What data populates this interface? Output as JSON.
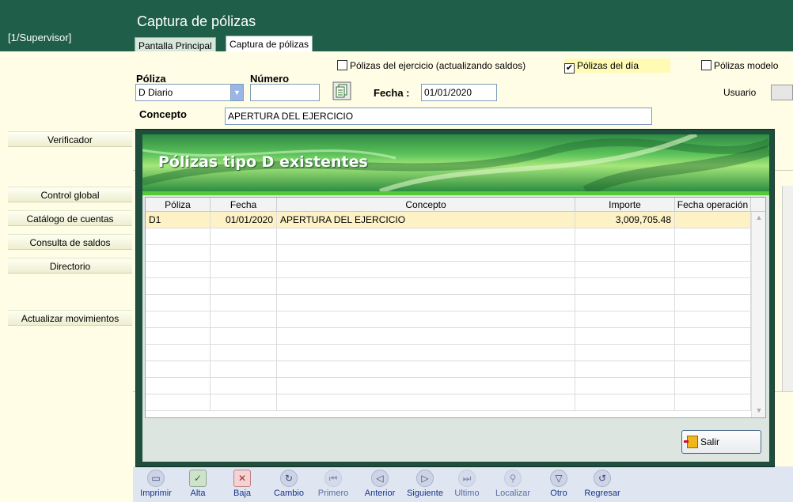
{
  "header": {
    "title": "Captura de pólizas",
    "user": "[1/Supervisor]",
    "tabs": [
      {
        "label": "Pantalla Principal",
        "active": false
      },
      {
        "label": "Captura de pólizas",
        "active": true
      }
    ]
  },
  "sidebar": {
    "items": [
      {
        "label": "Verificador"
      },
      {
        "label": "Control global"
      },
      {
        "label": "Catálogo de cuentas"
      },
      {
        "label": "Consulta de saldos"
      },
      {
        "label": "Directorio"
      },
      {
        "label": "Actualizar movimientos"
      }
    ]
  },
  "form": {
    "checks": [
      {
        "label": "Pólizas del ejercicio (actualizando saldos)",
        "checked": false
      },
      {
        "label": "Pólizas del día",
        "checked": true
      },
      {
        "label": "Pólizas modelo",
        "checked": false
      }
    ],
    "poliza_label": "Póliza",
    "poliza_value": "D Diario",
    "numero_label": "Número",
    "numero_value": "",
    "fecha_label": "Fecha :",
    "fecha_value": "01/01/2020",
    "usuario_label": "Usuario",
    "concepto_label": "Concepto",
    "concepto_value": "APERTURA DEL EJERCICIO"
  },
  "modal": {
    "title": "Pólizas tipo D existentes",
    "columns": [
      "Póliza",
      "Fecha",
      "Concepto",
      "Importe",
      "Fecha operación"
    ],
    "rows": [
      {
        "poliza": "D1",
        "fecha": "01/01/2020",
        "concepto": "APERTURA DEL EJERCICIO",
        "importe": "3,009,705.48",
        "fecha_operacion": ""
      }
    ],
    "salir_label": "Salir",
    "colors": {
      "frame": "#1e4e3c",
      "accent": "#55c83a",
      "selected_row": "#fdf2c6"
    }
  },
  "toolbar": {
    "buttons": [
      {
        "label": "Imprimir",
        "icon": "printer-icon"
      },
      {
        "label": "Alta",
        "icon": "add-icon"
      },
      {
        "label": "Baja",
        "icon": "delete-icon"
      },
      {
        "label": "Cambio",
        "icon": "refresh-icon"
      },
      {
        "label": "Primero",
        "icon": "first-icon"
      },
      {
        "label": "Anterior",
        "icon": "previous-icon"
      },
      {
        "label": "Siguiente",
        "icon": "next-icon"
      },
      {
        "label": "Ultimo",
        "icon": "last-icon"
      },
      {
        "label": "Localizar",
        "icon": "search-icon"
      },
      {
        "label": "Otro",
        "icon": "filter-icon"
      },
      {
        "label": "Regresar",
        "icon": "return-icon"
      }
    ]
  },
  "colors": {
    "header": "#1f5f4a",
    "background": "#fffde6",
    "toolbar": "#dfe6f2"
  }
}
